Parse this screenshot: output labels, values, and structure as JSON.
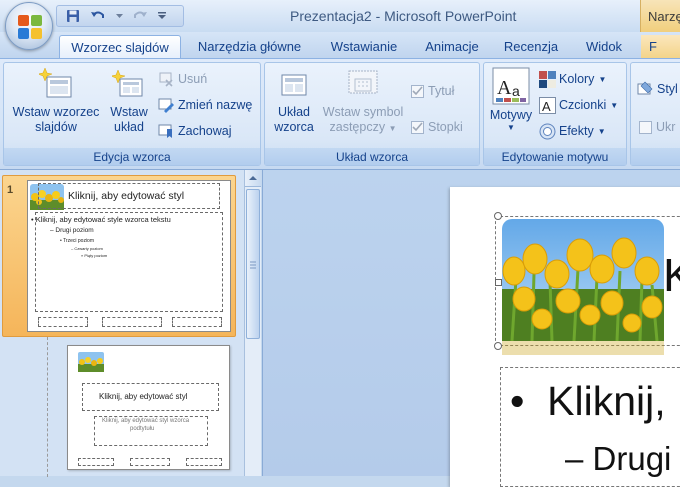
{
  "window": {
    "title": "Prezentacja2 - Microsoft PowerPoint",
    "context_group": "Narzę"
  },
  "tabs": [
    {
      "label": "Wzorzec slajdów",
      "active": true
    },
    {
      "label": "Narzędzia główne"
    },
    {
      "label": "Wstawianie"
    },
    {
      "label": "Animacje"
    },
    {
      "label": "Recenzja"
    },
    {
      "label": "Widok"
    },
    {
      "label": "F"
    }
  ],
  "ribbon": {
    "edycja": {
      "label": "Edycja wzorca",
      "insert_master_l1": "Wstaw wzorzec",
      "insert_master_l2": "slajdów",
      "insert_layout_l1": "Wstaw",
      "insert_layout_l2": "układ",
      "delete": "Usuń",
      "rename": "Zmień nazwę",
      "preserve": "Zachowaj"
    },
    "uklad": {
      "label": "Układ wzorca",
      "master_layout_l1": "Układ",
      "master_layout_l2": "wzorca",
      "insert_ph_l1": "Wstaw symbol",
      "insert_ph_l2": "zastępczy",
      "title": "Tytuł",
      "footers": "Stopki"
    },
    "motyw": {
      "label": "Edytowanie motywu",
      "themes": "Motywy",
      "colors": "Kolory",
      "fonts": "Czcionki",
      "effects": "Efekty"
    },
    "tlo": {
      "background_styles": "Styl",
      "hide_bg": "Ukr"
    }
  },
  "thumbnails": {
    "slide_number": "1",
    "master": {
      "title": "Kliknij, aby edytować styl",
      "l1": "Kliknij, aby edytować style wzorca tekstu",
      "l2": "Drugi poziom",
      "l3": "Trzeci poziom",
      "l4": "Czwarty poziom",
      "l5": "Piąty poziom"
    },
    "layout": {
      "title": "Kliknij, aby edytować styl",
      "subtitle_l1": "Kliknij, aby edytować styl wzorca",
      "subtitle_l2": "podtytułu"
    }
  },
  "slide": {
    "title_fragment": "K",
    "body_l1": "Kliknij,",
    "body_l2": "Drugi"
  },
  "colors": {
    "accent_orange": "#f5b55a",
    "ribbon_blue": "#dae7f7"
  }
}
